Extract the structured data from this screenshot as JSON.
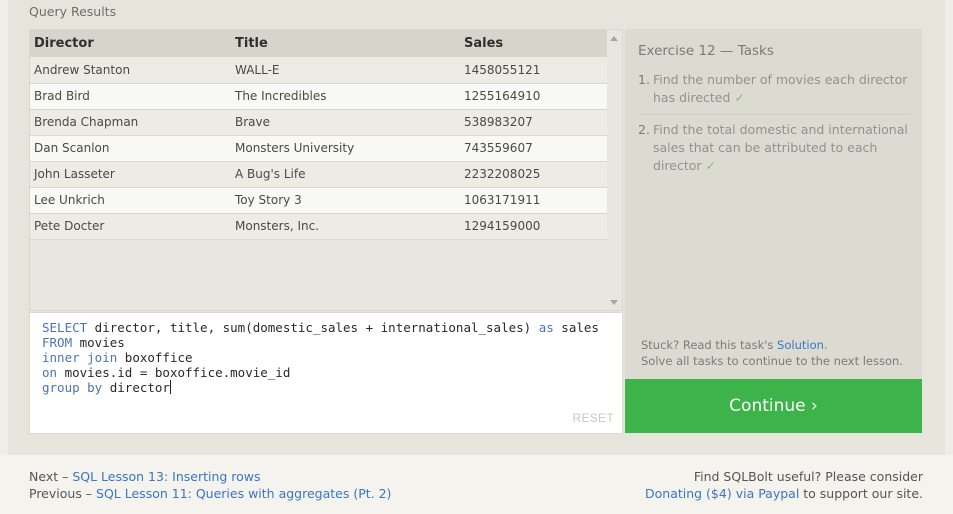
{
  "results": {
    "label": "Query Results",
    "columns": [
      "Director",
      "Title",
      "Sales"
    ],
    "rows": [
      [
        "Andrew Stanton",
        "WALL-E",
        "1458055121"
      ],
      [
        "Brad Bird",
        "The Incredibles",
        "1255164910"
      ],
      [
        "Brenda Chapman",
        "Brave",
        "538983207"
      ],
      [
        "Dan Scanlon",
        "Monsters University",
        "743559607"
      ],
      [
        "John Lasseter",
        "A Bug's Life",
        "2232208025"
      ],
      [
        "Lee Unkrich",
        "Toy Story 3",
        "1063171911"
      ],
      [
        "Pete Docter",
        "Monsters, Inc.",
        "1294159000"
      ]
    ]
  },
  "editor": {
    "lines": [
      [
        {
          "t": "SELECT",
          "kw": true
        },
        {
          "t": " director, title, sum(domestic_sales + international_sales) "
        },
        {
          "t": "as",
          "kw": true
        },
        {
          "t": " sales"
        }
      ],
      [
        {
          "t": "FROM",
          "kw": true
        },
        {
          "t": " movies"
        }
      ],
      [
        {
          "t": "inner join",
          "kw": true
        },
        {
          "t": " boxoffice"
        }
      ],
      [
        {
          "t": "on",
          "kw": true
        },
        {
          "t": " movies.id = boxoffice.movie_id"
        }
      ],
      [
        {
          "t": "group by",
          "kw": true
        },
        {
          "t": " director"
        }
      ]
    ],
    "reset_label": "RESET"
  },
  "tasks": {
    "title": "Exercise 12 — Tasks",
    "items": [
      {
        "num": "1.",
        "text": "Find the number of movies each director has directed",
        "done": "✓"
      },
      {
        "num": "2.",
        "text": "Find the total domestic and international sales that can be attributed to each director",
        "done": "✓"
      }
    ],
    "stuck_prefix": "Stuck? Read this task's ",
    "solution_link": "Solution",
    "stuck_suffix": ".",
    "solve_all": "Solve all tasks to continue to the next lesson."
  },
  "continue_label": "Continue ›",
  "footer": {
    "next_prefix": "Next – ",
    "next_link": "SQL Lesson 13: Inserting rows",
    "prev_prefix": "Previous – ",
    "prev_link": "SQL Lesson 11: Queries with aggregates (Pt. 2)",
    "useful": "Find SQLBolt useful? Please consider",
    "donate_link": "Donating ($4) via Paypal",
    "donate_suffix": " to support our site."
  },
  "colors": {
    "accent": "#3cb44a",
    "link": "#3b75c4",
    "keyword": "#4b74b8"
  }
}
